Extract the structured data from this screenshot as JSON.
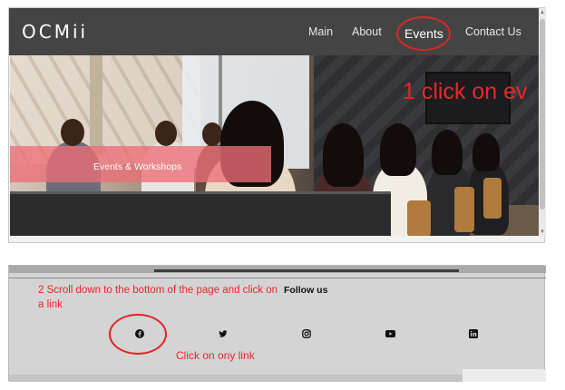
{
  "top_screenshot": {
    "logo": "OCMii",
    "nav": {
      "main": "Main",
      "about": "About",
      "events": "Events",
      "contact": "Contact Us"
    },
    "hero_caption": "Events & Workshops",
    "annotation": "1 click on ev"
  },
  "bottom_screenshot": {
    "annotation_scroll": "2 Scroll down to the bottom of the page and click on a link",
    "follow_label": "Follow us",
    "social_icons": [
      "facebook-icon",
      "twitter-icon",
      "instagram-icon",
      "youtube-icon",
      "linkedin-icon"
    ],
    "annotation_click": "Click on ony link"
  },
  "colors": {
    "annotation_red": "#e8262b",
    "navbar_bg": "#444444",
    "caption_band": "#ec6e76",
    "footer_bg": "#d4d4d4"
  }
}
